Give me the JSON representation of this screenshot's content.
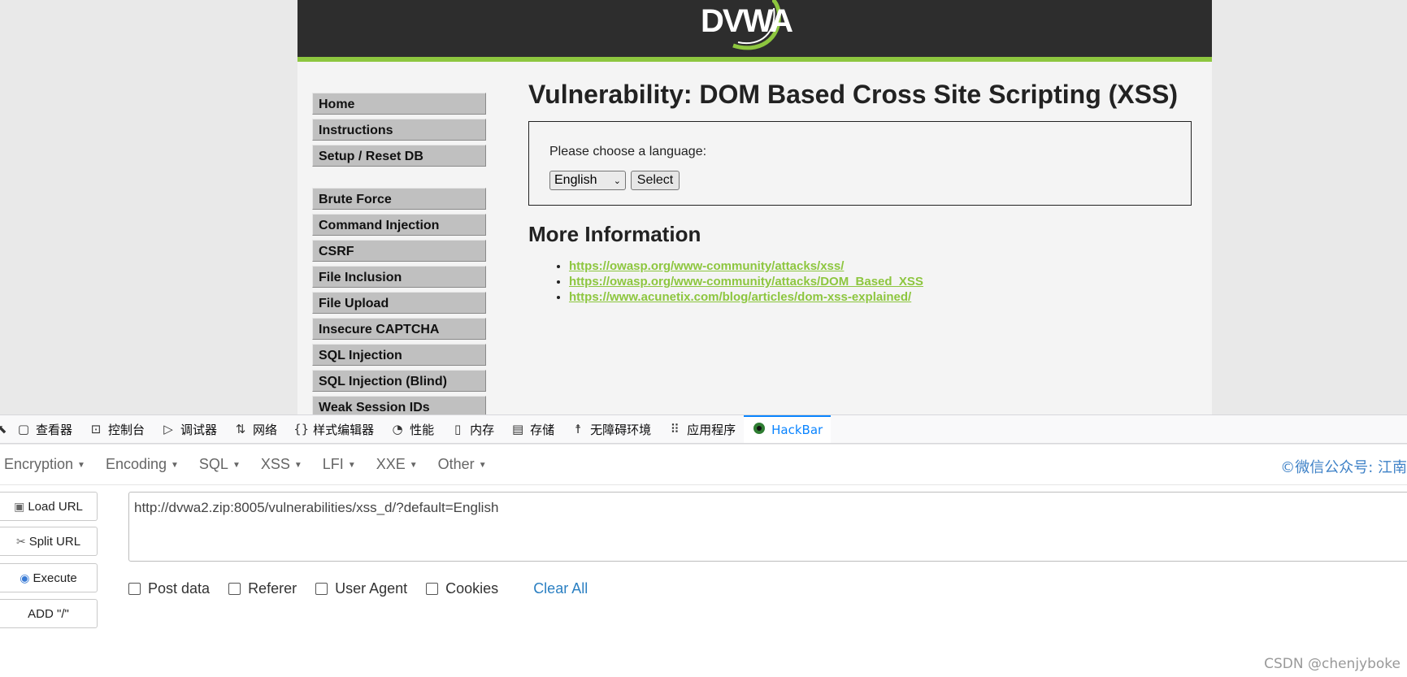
{
  "dvwa": {
    "logo_text": "DVWA",
    "menu_group1": [
      "Home",
      "Instructions",
      "Setup / Reset DB"
    ],
    "menu_group2": [
      "Brute Force",
      "Command Injection",
      "CSRF",
      "File Inclusion",
      "File Upload",
      "Insecure CAPTCHA",
      "SQL Injection",
      "SQL Injection (Blind)",
      "Weak Session IDs"
    ],
    "page_title": "Vulnerability: DOM Based Cross Site Scripting (XSS)",
    "form": {
      "label": "Please choose a language:",
      "selected_language": "English",
      "select_button": "Select"
    },
    "more_info_title": "More Information",
    "links": [
      "https://owasp.org/www-community/attacks/xss/",
      "https://owasp.org/www-community/attacks/DOM_Based_XSS",
      "https://www.acunetix.com/blog/articles/dom-xss-explained/"
    ],
    "colors": {
      "header_bg": "#2d2d2d",
      "accent_green": "#8dc63f"
    }
  },
  "devtools": {
    "tabs": [
      {
        "label": "查看器",
        "icon": "inspector-icon"
      },
      {
        "label": "控制台",
        "icon": "console-icon"
      },
      {
        "label": "调试器",
        "icon": "debugger-icon"
      },
      {
        "label": "网络",
        "icon": "network-icon"
      },
      {
        "label": "样式编辑器",
        "icon": "style-editor-icon"
      },
      {
        "label": "性能",
        "icon": "performance-icon"
      },
      {
        "label": "内存",
        "icon": "memory-icon"
      },
      {
        "label": "存储",
        "icon": "storage-icon"
      },
      {
        "label": "无障碍环境",
        "icon": "accessibility-icon"
      },
      {
        "label": "应用程序",
        "icon": "application-icon"
      },
      {
        "label": "HackBar",
        "icon": "hackbar-icon"
      }
    ],
    "active_tab": "HackBar"
  },
  "hackbar": {
    "menu": [
      "Encryption",
      "Encoding",
      "SQL",
      "XSS",
      "LFI",
      "XXE",
      "Other"
    ],
    "credit": "©微信公众号: 江南",
    "buttons": {
      "load_url": "Load URL",
      "split_url": "Split URL",
      "execute": "Execute",
      "add_slash": "ADD \"/\""
    },
    "url": "http://dvwa2.zip:8005/vulnerabilities/xss_d/?default=English",
    "options": {
      "post_data": "Post data",
      "referer": "Referer",
      "user_agent": "User Agent",
      "cookies": "Cookies",
      "clear_all": "Clear All"
    }
  },
  "watermark": "CSDN @chenjyboke"
}
